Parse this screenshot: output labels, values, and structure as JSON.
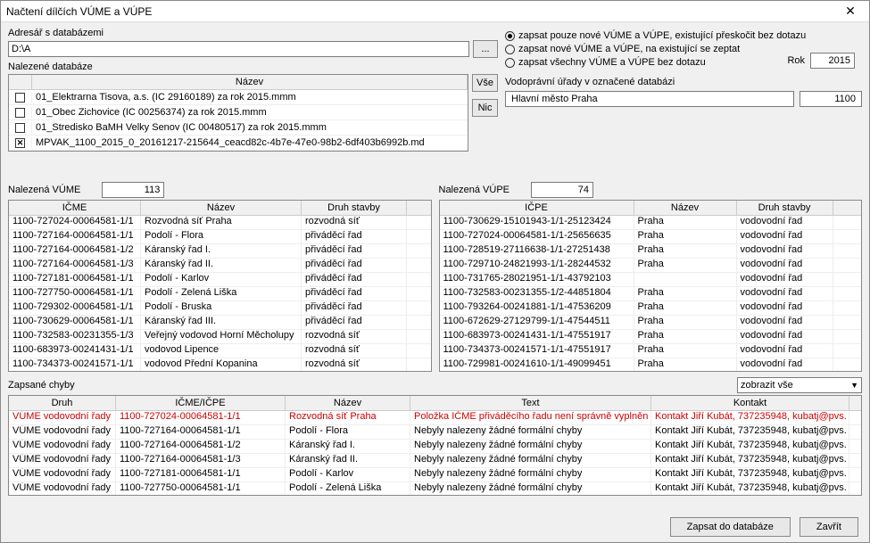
{
  "window": {
    "title": "Načtení dílčích VÚME a VÚPE"
  },
  "dir": {
    "label": "Adresář s databázemi",
    "value": "D:\\A",
    "browse": "..."
  },
  "dbs": {
    "label": "Nalezené databáze",
    "header": "Název",
    "btn_all": "Vše",
    "btn_none": "Nic",
    "rows": [
      {
        "checked": false,
        "name": "01_Elektrarna Tisova, a.s. (IC 29160189) za rok 2015.mmm"
      },
      {
        "checked": false,
        "name": "01_Obec Zichovice (IC 00256374) za rok 2015.mmm"
      },
      {
        "checked": false,
        "name": "01_Stredisko BaMH Velky Senov (IC 00480517) za rok 2015.mmm"
      },
      {
        "checked": true,
        "name": "MPVAK_1100_2015_0_20161217-215644_ceacd82c-4b7e-47e0-98b2-6df403b6992b.md"
      }
    ]
  },
  "options": {
    "r1": "zapsat pouze nové VÚME a VÚPE, existující přeskočit bez dotazu",
    "r2": "zapsat nové VÚME a VÚPE, na existující se zeptat",
    "r3": "zapsat všechny VÚME a VÚPE bez dotazu",
    "selected": 0
  },
  "year": {
    "label": "Rok",
    "value": "2015"
  },
  "vu": {
    "label": "Vodoprávní úřady v označené databázi",
    "name": "Hlavní město Praha",
    "code": "1100"
  },
  "vume": {
    "label": "Nalezená VÚME",
    "count": "113",
    "headers": [
      "IČME",
      "Název",
      "Druh stavby"
    ],
    "rows": [
      [
        "1100-727024-00064581-1/1",
        "Rozvodná síť Praha",
        "rozvodná síť"
      ],
      [
        "1100-727164-00064581-1/1",
        "Podolí - Flora",
        "přiváděcí řad"
      ],
      [
        "1100-727164-00064581-1/2",
        "Káranský řad I.",
        "přiváděcí řad"
      ],
      [
        "1100-727164-00064581-1/3",
        "Káranský řad II.",
        "přiváděcí řad"
      ],
      [
        "1100-727181-00064581-1/1",
        "Podolí - Karlov",
        "přiváděcí řad"
      ],
      [
        "1100-727750-00064581-1/1",
        "Podolí - Zelená Liška",
        "přiváděcí řad"
      ],
      [
        "1100-729302-00064581-1/1",
        "Podolí - Bruska",
        "přiváděcí řad"
      ],
      [
        "1100-730629-00064581-1/1",
        "Káranský řad III.",
        "přiváděcí řad"
      ],
      [
        "1100-732583-00231355-1/3",
        "Veřejný vodovod Horní Měcholupy",
        "rozvodná síť"
      ],
      [
        "1100-683973-00241431-1/1",
        "vodovod Lipence",
        "rozvodná síť"
      ],
      [
        "1100-734373-00241571-1/1",
        "vodovod Přední Kopanina",
        "rozvodná síť"
      ]
    ]
  },
  "vupe": {
    "label": "Nalezená VÚPE",
    "count": "74",
    "headers": [
      "IČPE",
      "Název",
      "Druh stavby"
    ],
    "rows": [
      [
        "1100-730629-15101943-1/1-25123424",
        "Praha",
        "vodovodní řad"
      ],
      [
        "1100-727024-00064581-1/1-25656635",
        "Praha",
        "vodovodní řad"
      ],
      [
        "1100-728519-27116638-1/1-27251438",
        "Praha",
        "vodovodní řad"
      ],
      [
        "1100-729710-24821993-1/1-28244532",
        "Praha",
        "vodovodní řad"
      ],
      [
        "1100-731765-28021951-1/1-43792103",
        "",
        "vodovodní řad"
      ],
      [
        "1100-732583-00231355-1/2-44851804",
        "Praha",
        "vodovodní řad"
      ],
      [
        "1100-793264-00241881-1/1-47536209",
        "Praha",
        "vodovodní řad"
      ],
      [
        "1100-672629-27129799-1/1-47544511",
        "Praha",
        "vodovodní řad"
      ],
      [
        "1100-683973-00241431-1/1-47551917",
        "Praha",
        "vodovodní řad"
      ],
      [
        "1100-734373-00241571-1/1-47551917",
        "Praha",
        "vodovodní řad"
      ],
      [
        "1100-729981-00241610-1/1-49099451",
        "Praha",
        "vodovodní řad"
      ]
    ]
  },
  "errors": {
    "label": "Zapsané chyby",
    "filter": "zobrazit vše",
    "headers": [
      "Druh",
      "IČME/IČPE",
      "Název",
      "Text",
      "Kontakt"
    ],
    "rows": [
      {
        "red": true,
        "c": [
          "VÚME vodovodní řady",
          "1100-727024-00064581-1/1",
          "Rozvodná síť Praha",
          "Položka IČME přiváděcího řadu není správně vyplněn",
          "Kontakt Jiří Kubát, 737235948, kubatj@pvs."
        ]
      },
      {
        "red": false,
        "c": [
          "VÚME vodovodní řady",
          "1100-727164-00064581-1/1",
          "Podolí - Flora",
          "Nebyly nalezeny žádné formální chyby",
          "Kontakt Jiří Kubát, 737235948, kubatj@pvs."
        ]
      },
      {
        "red": false,
        "c": [
          "VÚME vodovodní řady",
          "1100-727164-00064581-1/2",
          "Káranský řad I.",
          "Nebyly nalezeny žádné formální chyby",
          "Kontakt Jiří Kubát, 737235948, kubatj@pvs."
        ]
      },
      {
        "red": false,
        "c": [
          "VÚME vodovodní řady",
          "1100-727164-00064581-1/3",
          "Káranský řad II.",
          "Nebyly nalezeny žádné formální chyby",
          "Kontakt Jiří Kubát, 737235948, kubatj@pvs."
        ]
      },
      {
        "red": false,
        "c": [
          "VÚME vodovodní řady",
          "1100-727181-00064581-1/1",
          "Podolí - Karlov",
          "Nebyly nalezeny žádné formální chyby",
          "Kontakt Jiří Kubát, 737235948, kubatj@pvs."
        ]
      },
      {
        "red": false,
        "c": [
          "VÚME vodovodní řady",
          "1100-727750-00064581-1/1",
          "Podolí - Zelená Liška",
          "Nebyly nalezeny žádné formální chyby",
          "Kontakt Jiří Kubát, 737235948, kubatj@pvs."
        ]
      }
    ]
  },
  "footer": {
    "save": "Zapsat do databáze",
    "close": "Zavřít"
  }
}
